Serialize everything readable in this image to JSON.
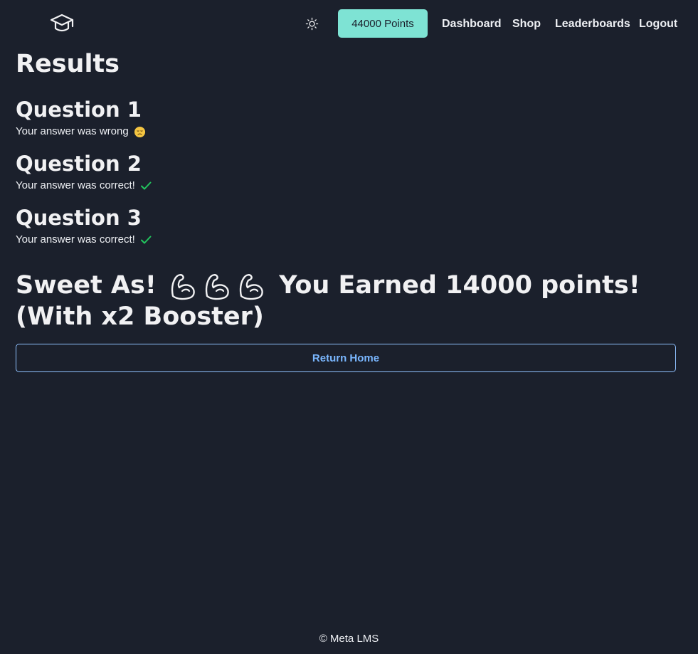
{
  "navbar": {
    "logo_icon": "graduation-cap-icon",
    "theme_icon": "sun-icon",
    "points_label": "44000 Points",
    "links": {
      "dashboard": "Dashboard",
      "shop": "Shop",
      "leaderboards": "Leaderboards",
      "logout": "Logout"
    }
  },
  "main": {
    "title": "Results",
    "questions": [
      {
        "title": "Question 1",
        "answer": "Your answer was wrong",
        "icon": "sad-face-icon"
      },
      {
        "title": "Question 2",
        "answer": "Your answer was correct!",
        "icon": "check-icon"
      },
      {
        "title": "Question 3",
        "answer": "Your answer was correct!",
        "icon": "check-icon"
      }
    ],
    "result": {
      "prefix": "Sweet As!",
      "icons": [
        "flexed-biceps-icon",
        "flexed-biceps-icon",
        "flexed-biceps-icon"
      ],
      "suffix": "You Earned 14000 points! (With x2 Booster)"
    },
    "return_label": "Return Home"
  },
  "footer": {
    "text": "© Meta LMS"
  },
  "colors": {
    "background": "#1b202c",
    "points_button": "#7ee3d4",
    "accent_blue": "#7ab7ff",
    "check_green": "#22c55e",
    "emoji_yellow": "#f4c542"
  }
}
